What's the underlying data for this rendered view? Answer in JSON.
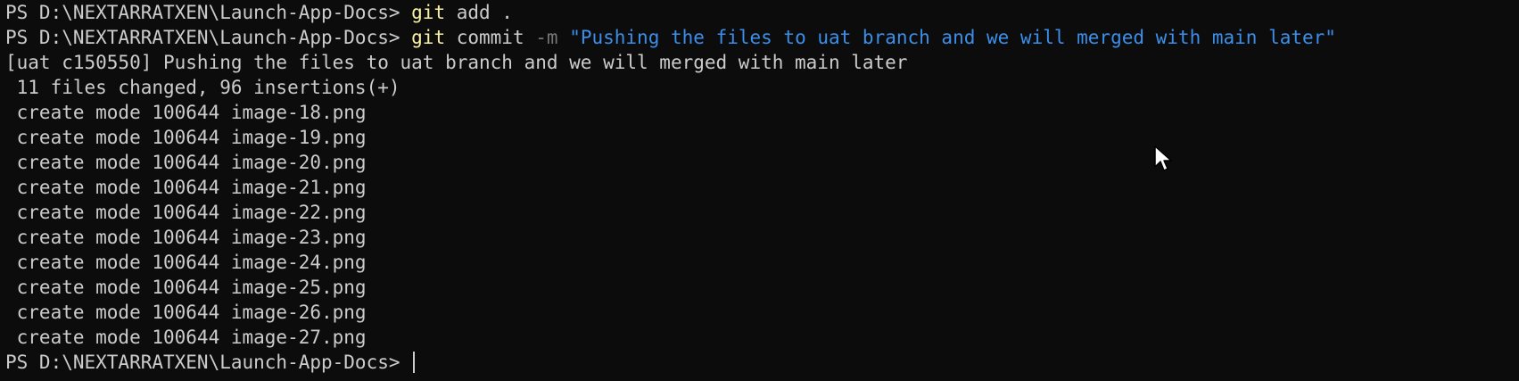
{
  "colors": {
    "background": "#0c0c0c",
    "text": "#cccccc",
    "command": "#f9f1a5",
    "flag": "#767676",
    "string": "#3b8eea"
  },
  "line1": {
    "prompt": "PS D:\\NEXTARRATXEN\\Launch-App-Docs> ",
    "cmd": "git",
    "args": " add ."
  },
  "line2": {
    "prompt": "PS D:\\NEXTARRATXEN\\Launch-App-Docs> ",
    "cmd": "git",
    "args": " commit ",
    "flag": "-m",
    "space": " ",
    "message": "\"Pushing the files to uat branch and we will merged with main later\""
  },
  "output": {
    "commit_line": "[uat c150550] Pushing the files to uat branch and we will merged with main later",
    "summary": " 11 files changed, 96 insertions(+)",
    "files": [
      " create mode 100644 image-18.png",
      " create mode 100644 image-19.png",
      " create mode 100644 image-20.png",
      " create mode 100644 image-21.png",
      " create mode 100644 image-22.png",
      " create mode 100644 image-23.png",
      " create mode 100644 image-24.png",
      " create mode 100644 image-25.png",
      " create mode 100644 image-26.png",
      " create mode 100644 image-27.png"
    ]
  },
  "last_prompt": "PS D:\\NEXTARRATXEN\\Launch-App-Docs> ",
  "icons": {
    "mouse": "mouse-pointer-icon"
  }
}
